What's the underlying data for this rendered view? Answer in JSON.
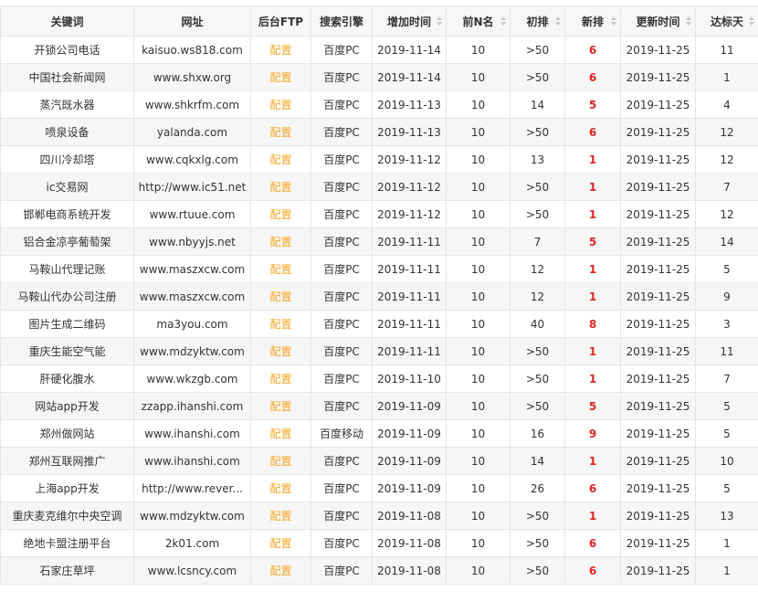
{
  "columns": [
    "关键词",
    "网址",
    "后台FTP",
    "搜索引擎",
    "增加时间",
    "前N名",
    "初排",
    "新排",
    "更新时间",
    "达标天"
  ],
  "sortable_columns": [
    4,
    5,
    6,
    7,
    8,
    9
  ],
  "colors": {
    "ftp_link": "#f5a623",
    "new_rank": "#e02424",
    "header_bg": "#f7f7f7",
    "alt_row_bg": "#f6f6f6",
    "border": "#e6e6e6"
  },
  "rows": [
    {
      "keyword": "开锁公司电话",
      "url": "kaisuo.ws818.com",
      "ftp": "配置",
      "engine": "百度PC",
      "added": "2019-11-14",
      "topn": "10",
      "initial": ">50",
      "new": "6",
      "updated": "2019-11-25",
      "days": "11"
    },
    {
      "keyword": "中国社会新闻网",
      "url": "www.shxw.org",
      "ftp": "配置",
      "engine": "百度PC",
      "added": "2019-11-14",
      "topn": "10",
      "initial": ">50",
      "new": "6",
      "updated": "2019-11-25",
      "days": "1"
    },
    {
      "keyword": "蒸汽既水器",
      "url": "www.shkrfm.com",
      "ftp": "配置",
      "engine": "百度PC",
      "added": "2019-11-13",
      "topn": "10",
      "initial": "14",
      "new": "5",
      "updated": "2019-11-25",
      "days": "4"
    },
    {
      "keyword": "喷泉设备",
      "url": "yalanda.com",
      "ftp": "配置",
      "engine": "百度PC",
      "added": "2019-11-13",
      "topn": "10",
      "initial": ">50",
      "new": "6",
      "updated": "2019-11-25",
      "days": "12"
    },
    {
      "keyword": "四川冷却塔",
      "url": "www.cqkxlg.com",
      "ftp": "配置",
      "engine": "百度PC",
      "added": "2019-11-12",
      "topn": "10",
      "initial": "13",
      "new": "1",
      "updated": "2019-11-25",
      "days": "12"
    },
    {
      "keyword": "ic交易网",
      "url": "http://www.ic51.net",
      "ftp": "配置",
      "engine": "百度PC",
      "added": "2019-11-12",
      "topn": "10",
      "initial": ">50",
      "new": "1",
      "updated": "2019-11-25",
      "days": "7"
    },
    {
      "keyword": "邯郸电商系统开发",
      "url": "www.rtuue.com",
      "ftp": "配置",
      "engine": "百度PC",
      "added": "2019-11-12",
      "topn": "10",
      "initial": ">50",
      "new": "1",
      "updated": "2019-11-25",
      "days": "12"
    },
    {
      "keyword": "铝合金凉亭葡萄架",
      "url": "www.nbyyjs.net",
      "ftp": "配置",
      "engine": "百度PC",
      "added": "2019-11-11",
      "topn": "10",
      "initial": "7",
      "new": "5",
      "updated": "2019-11-25",
      "days": "14"
    },
    {
      "keyword": "马鞍山代理记账",
      "url": "www.maszxcw.com",
      "ftp": "配置",
      "engine": "百度PC",
      "added": "2019-11-11",
      "topn": "10",
      "initial": "12",
      "new": "1",
      "updated": "2019-11-25",
      "days": "5"
    },
    {
      "keyword": "马鞍山代办公司注册",
      "url": "www.maszxcw.com",
      "ftp": "配置",
      "engine": "百度PC",
      "added": "2019-11-11",
      "topn": "10",
      "initial": "12",
      "new": "1",
      "updated": "2019-11-25",
      "days": "9"
    },
    {
      "keyword": "图片生成二维码",
      "url": "ma3you.com",
      "ftp": "配置",
      "engine": "百度PC",
      "added": "2019-11-11",
      "topn": "10",
      "initial": "40",
      "new": "8",
      "updated": "2019-11-25",
      "days": "3"
    },
    {
      "keyword": "重庆生能空气能",
      "url": "www.mdzyktw.com",
      "ftp": "配置",
      "engine": "百度PC",
      "added": "2019-11-11",
      "topn": "10",
      "initial": ">50",
      "new": "1",
      "updated": "2019-11-25",
      "days": "11"
    },
    {
      "keyword": "肝硬化腹水",
      "url": "www.wkzgb.com",
      "ftp": "配置",
      "engine": "百度PC",
      "added": "2019-11-10",
      "topn": "10",
      "initial": ">50",
      "new": "1",
      "updated": "2019-11-25",
      "days": "7"
    },
    {
      "keyword": "网站app开发",
      "url": "zzapp.ihanshi.com",
      "ftp": "配置",
      "engine": "百度PC",
      "added": "2019-11-09",
      "topn": "10",
      "initial": ">50",
      "new": "5",
      "updated": "2019-11-25",
      "days": "5"
    },
    {
      "keyword": "郑州做网站",
      "url": "www.ihanshi.com",
      "ftp": "配置",
      "engine": "百度移动",
      "added": "2019-11-09",
      "topn": "10",
      "initial": "16",
      "new": "9",
      "updated": "2019-11-25",
      "days": "5"
    },
    {
      "keyword": "郑州互联网推广",
      "url": "www.ihanshi.com",
      "ftp": "配置",
      "engine": "百度PC",
      "added": "2019-11-09",
      "topn": "10",
      "initial": "14",
      "new": "1",
      "updated": "2019-11-25",
      "days": "10"
    },
    {
      "keyword": "上海app开发",
      "url": "http://www.rever...",
      "ftp": "配置",
      "engine": "百度PC",
      "added": "2019-11-09",
      "topn": "10",
      "initial": "26",
      "new": "6",
      "updated": "2019-11-25",
      "days": "5"
    },
    {
      "keyword": "重庆麦克维尔中央空调",
      "url": "www.mdzyktw.com",
      "ftp": "配置",
      "engine": "百度PC",
      "added": "2019-11-08",
      "topn": "10",
      "initial": ">50",
      "new": "1",
      "updated": "2019-11-25",
      "days": "13"
    },
    {
      "keyword": "绝地卡盟注册平台",
      "url": "2k01.com",
      "ftp": "配置",
      "engine": "百度PC",
      "added": "2019-11-08",
      "topn": "10",
      "initial": ">50",
      "new": "6",
      "updated": "2019-11-25",
      "days": "1"
    },
    {
      "keyword": "石家庄草坪",
      "url": "www.lcsncy.com",
      "ftp": "配置",
      "engine": "百度PC",
      "added": "2019-11-08",
      "topn": "10",
      "initial": ">50",
      "new": "6",
      "updated": "2019-11-25",
      "days": "1"
    }
  ]
}
